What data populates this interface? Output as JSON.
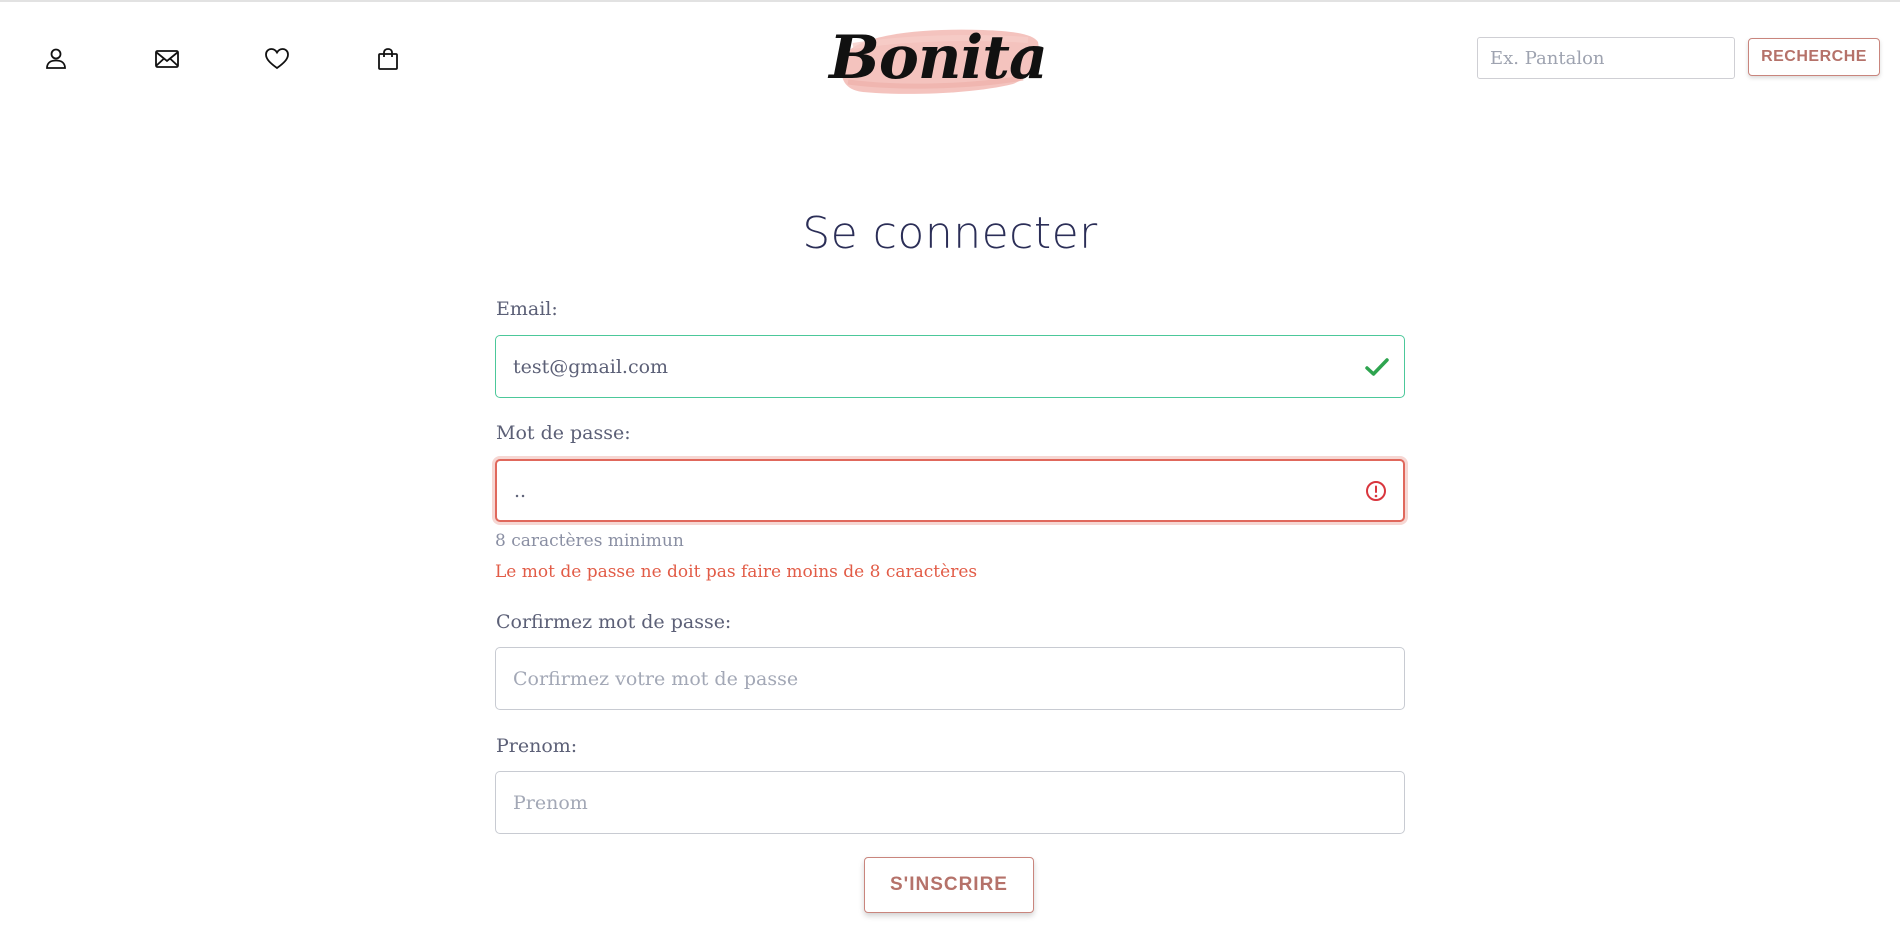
{
  "header": {
    "logo_text": "Bonita",
    "nav_icons": [
      "user-icon",
      "mail-icon",
      "heart-icon",
      "shopping-bag-icon"
    ],
    "search": {
      "placeholder": "Ex. Pantalon",
      "value": "",
      "button_label": "RECHERCHE"
    }
  },
  "page": {
    "title": "Se connecter"
  },
  "form": {
    "email": {
      "label": "Email:",
      "value": "test@gmail.com",
      "placeholder": "",
      "status": "valid"
    },
    "password": {
      "label": "Mot de passe:",
      "value": "..",
      "status": "invalid",
      "hint": "8 caractères minimun",
      "error": "Le mot de passe ne doit pas faire moins de 8 caractères"
    },
    "confirm_password": {
      "label": "Corfirmez mot de passe:",
      "placeholder": "Corfirmez votre mot de passe",
      "value": ""
    },
    "first_name": {
      "label": "Prenom:",
      "placeholder": "Prenom",
      "value": ""
    },
    "submit_label": "S'INSCRIRE"
  },
  "colors": {
    "accent": "#b5726a",
    "valid": "#2ea44f",
    "invalid": "#d9363e",
    "title": "#2b2e57"
  }
}
